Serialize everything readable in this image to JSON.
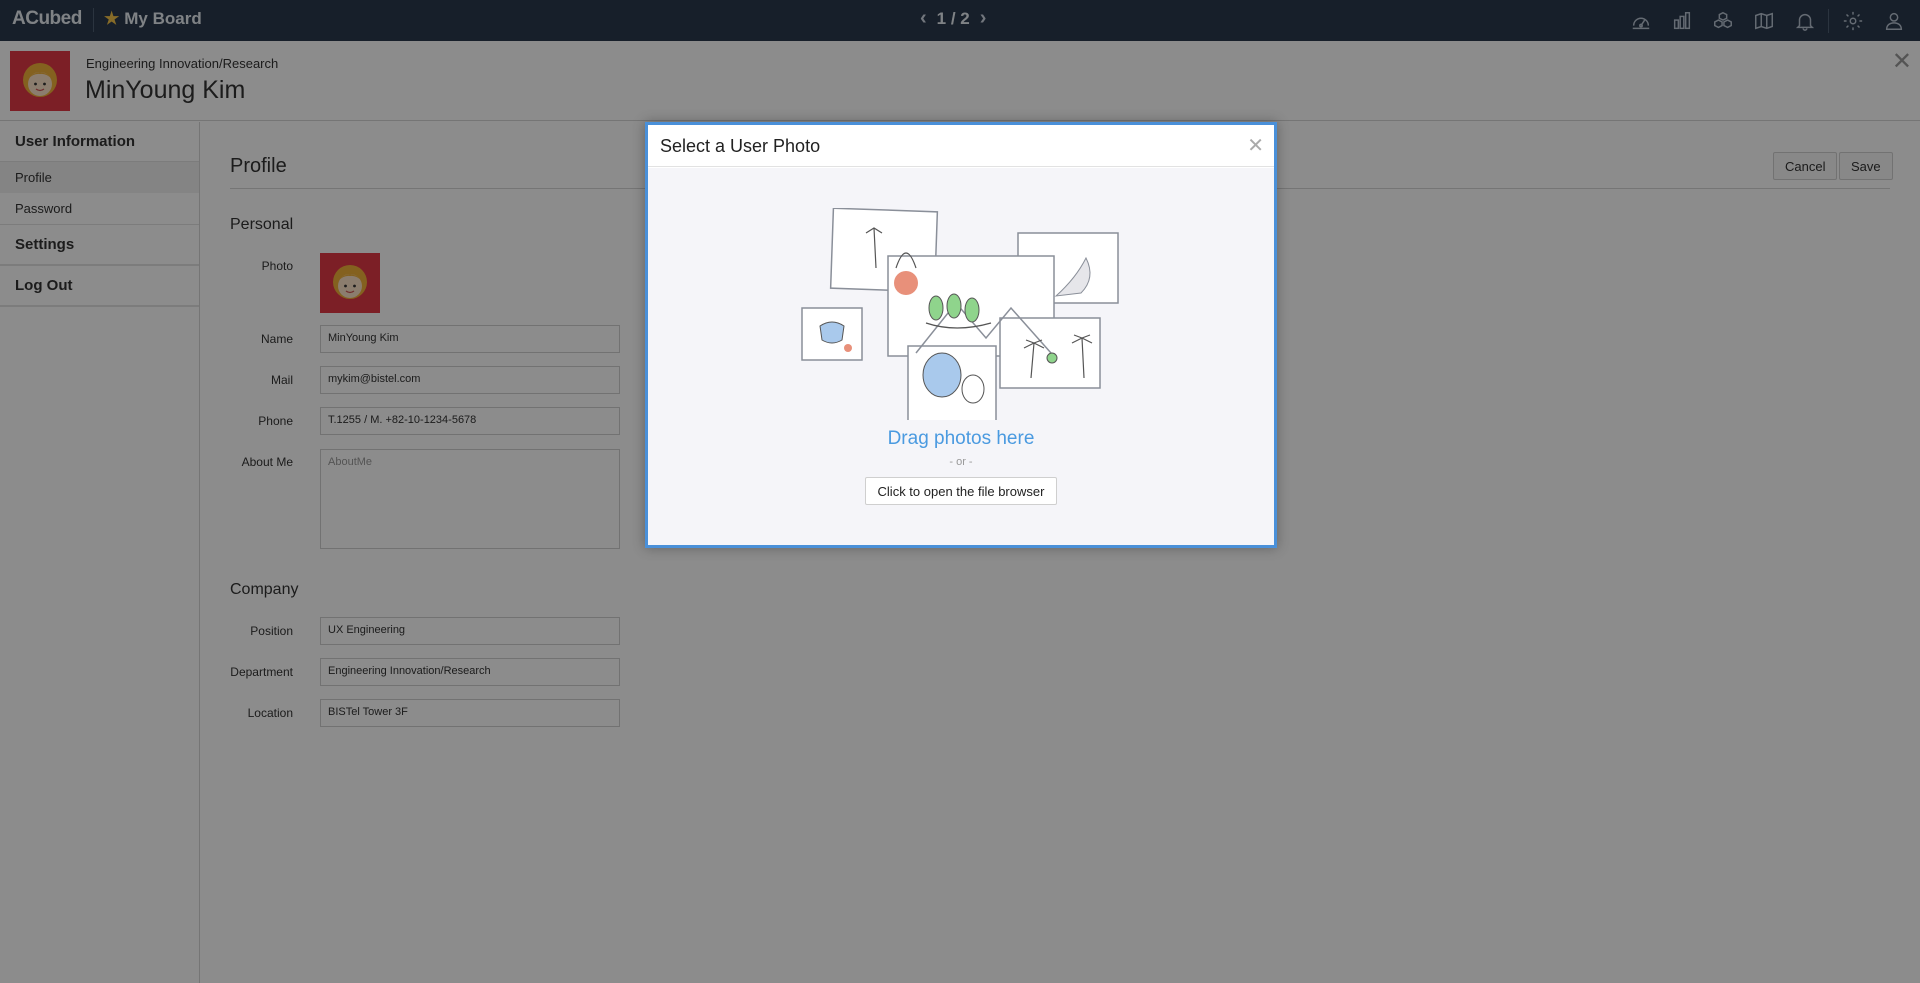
{
  "topbar": {
    "logo": "ACubed",
    "board_label": "My Board",
    "pager": "1 / 2",
    "icons": [
      "dashboard-icon",
      "chart-icon",
      "cubes-icon",
      "map-icon",
      "bell-icon",
      "gear-icon",
      "user-icon"
    ]
  },
  "header": {
    "department": "Engineering Innovation/Research",
    "name": "MinYoung Kim"
  },
  "sidebar": {
    "sections": [
      {
        "label": "User Information",
        "items": [
          {
            "label": "Profile",
            "active": true
          },
          {
            "label": "Password",
            "active": false
          }
        ]
      },
      {
        "label": "Settings",
        "items": []
      },
      {
        "label": "Log Out",
        "items": []
      }
    ]
  },
  "main": {
    "title": "Profile",
    "cancel_label": "Cancel",
    "save_label": "Save",
    "personal": {
      "title": "Personal",
      "photo_label": "Photo",
      "name_label": "Name",
      "name_value": "MinYoung Kim",
      "mail_label": "Mail",
      "mail_value": "mykim@bistel.com",
      "phone_label": "Phone",
      "phone_value": "T.1255 / M. +82-10-1234-5678",
      "about_label": "About Me",
      "about_placeholder": "AboutMe"
    },
    "company": {
      "title": "Company",
      "position_label": "Position",
      "position_value": "UX Engineering",
      "department_label": "Department",
      "department_value": "Engineering Innovation/Research",
      "location_label": "Location",
      "location_value": "BISTel Tower 3F"
    }
  },
  "modal": {
    "title": "Select a User Photo",
    "drag_text": "Drag photos here",
    "or_text": "- or -",
    "browse_label": "Click to open the file browser"
  },
  "colors": {
    "topbar": "#2b3a4d",
    "accent": "#4a90d9",
    "avatar": "#e23a45",
    "link": "#4a9ae0"
  }
}
